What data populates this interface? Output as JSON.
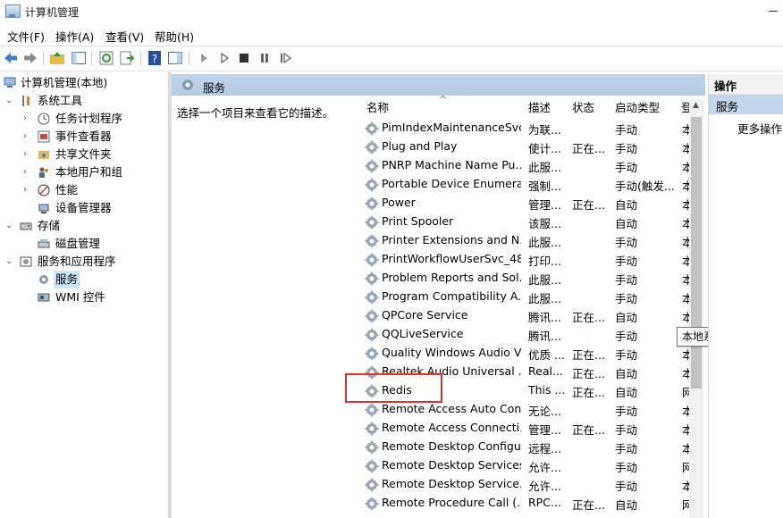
{
  "window": {
    "title": "计算机管理"
  },
  "menu": [
    "文件(F)",
    "操作(A)",
    "查看(V)",
    "帮助(H)"
  ],
  "tree": [
    {
      "label": "计算机管理(本地)",
      "icon": "computer-management-icon",
      "level": 0,
      "arrow": ""
    },
    {
      "label": "系统工具",
      "icon": "tools-icon",
      "level": 1,
      "arrow": "down"
    },
    {
      "label": "任务计划程序",
      "icon": "clock-icon",
      "level": 2,
      "arrow": "right"
    },
    {
      "label": "事件查看器",
      "icon": "event-viewer-icon",
      "level": 2,
      "arrow": "right"
    },
    {
      "label": "共享文件夹",
      "icon": "shared-folder-icon",
      "level": 2,
      "arrow": "right"
    },
    {
      "label": "本地用户和组",
      "icon": "users-icon",
      "level": 2,
      "arrow": "right"
    },
    {
      "label": "性能",
      "icon": "performance-icon",
      "level": 2,
      "arrow": "right"
    },
    {
      "label": "设备管理器",
      "icon": "device-manager-icon",
      "level": 2,
      "arrow": ""
    },
    {
      "label": "存储",
      "icon": "storage-icon",
      "level": 1,
      "arrow": "down"
    },
    {
      "label": "磁盘管理",
      "icon": "disk-icon",
      "level": 2,
      "arrow": ""
    },
    {
      "label": "服务和应用程序",
      "icon": "services-apps-icon",
      "level": 1,
      "arrow": "down"
    },
    {
      "label": "服务",
      "icon": "gear-icon",
      "level": 2,
      "arrow": "",
      "selected": true
    },
    {
      "label": "WMI 控件",
      "icon": "wmi-icon",
      "level": 2,
      "arrow": ""
    }
  ],
  "middle": {
    "title": "服务",
    "description": "选择一个项目来查看它的描述。",
    "columns": {
      "name": "名称",
      "desc": "描述",
      "status": "状态",
      "startup": "启动类型",
      "logon": "登"
    },
    "rows": [
      {
        "name": "PimIndexMaintenanceSvc...",
        "desc": "为联...",
        "status": "",
        "startup": "手动",
        "logon": "本"
      },
      {
        "name": "Plug and Play",
        "desc": "使计...",
        "status": "正在...",
        "startup": "手动",
        "logon": "本"
      },
      {
        "name": "PNRP Machine Name Pu...",
        "desc": "此服...",
        "status": "",
        "startup": "手动",
        "logon": "本"
      },
      {
        "name": "Portable Device Enumera...",
        "desc": "强制...",
        "status": "",
        "startup": "手动(触发...",
        "logon": "本"
      },
      {
        "name": "Power",
        "desc": "管理...",
        "status": "正在...",
        "startup": "自动",
        "logon": "本"
      },
      {
        "name": "Print Spooler",
        "desc": "该服...",
        "status": "",
        "startup": "自动",
        "logon": "本"
      },
      {
        "name": "Printer Extensions and N...",
        "desc": "此服...",
        "status": "",
        "startup": "手动",
        "logon": "本"
      },
      {
        "name": "PrintWorkflowUserSvc_48...",
        "desc": "打印...",
        "status": "",
        "startup": "手动",
        "logon": "本"
      },
      {
        "name": "Problem Reports and Sol...",
        "desc": "此服...",
        "status": "",
        "startup": "手动",
        "logon": "本"
      },
      {
        "name": "Program Compatibility A...",
        "desc": "此服...",
        "status": "",
        "startup": "手动",
        "logon": "本"
      },
      {
        "name": "QPCore Service",
        "desc": "腾讯...",
        "status": "正在...",
        "startup": "自动",
        "logon": "本"
      },
      {
        "name": "QQLiveService",
        "desc": "腾讯...",
        "status": "",
        "startup": "手动",
        "logon": "本"
      },
      {
        "name": "Quality Windows Audio V...",
        "desc": "优质 ...",
        "status": "正在...",
        "startup": "手动",
        "logon": "本"
      },
      {
        "name": "Realtek Audio Universal ...",
        "desc": "Real...",
        "status": "正在...",
        "startup": "自动",
        "logon": "本"
      },
      {
        "name": "Redis",
        "desc": "This ...",
        "status": "正在...",
        "startup": "自动",
        "logon": "网"
      },
      {
        "name": "Remote Access Auto Con...",
        "desc": "无论...",
        "status": "",
        "startup": "手动",
        "logon": "本"
      },
      {
        "name": "Remote Access Connecti...",
        "desc": "管理...",
        "status": "正在...",
        "startup": "手动",
        "logon": "本"
      },
      {
        "name": "Remote Desktop Configu...",
        "desc": "远程...",
        "status": "",
        "startup": "手动",
        "logon": "本"
      },
      {
        "name": "Remote Desktop Services",
        "desc": "允许...",
        "status": "",
        "startup": "手动",
        "logon": "网"
      },
      {
        "name": "Remote Desktop Service...",
        "desc": "允许...",
        "status": "",
        "startup": "手动",
        "logon": "本"
      },
      {
        "name": "Remote Procedure Call (...",
        "desc": "RPC...",
        "status": "正在...",
        "startup": "自动",
        "logon": "网"
      }
    ],
    "tooltip": "本地系统"
  },
  "actions": {
    "header": "操作",
    "selected": "服务",
    "more": "更多操作"
  },
  "colors": {
    "header_bg": "#c3d5ea",
    "selection": "#cce8ff",
    "highlight": "#e0302a"
  }
}
